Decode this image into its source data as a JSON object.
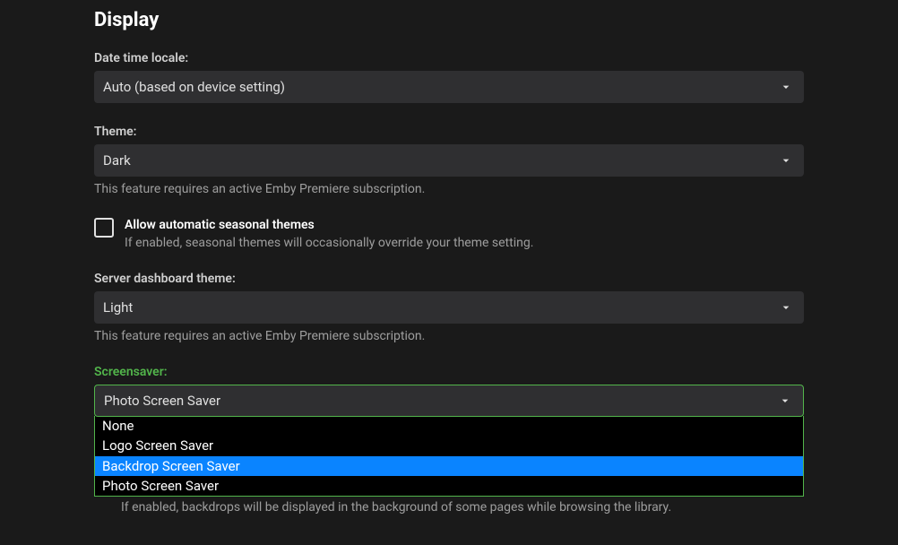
{
  "title": "Display",
  "datetime_locale": {
    "label": "Date time locale:",
    "value": "Auto (based on device setting)"
  },
  "theme": {
    "label": "Theme:",
    "value": "Dark",
    "help": "This feature requires an active Emby Premiere subscription."
  },
  "seasonal": {
    "label": "Allow automatic seasonal themes",
    "help": "If enabled, seasonal themes will occasionally override your theme setting."
  },
  "server_theme": {
    "label": "Server dashboard theme:",
    "value": "Light",
    "help": "This feature requires an active Emby Premiere subscription."
  },
  "screensaver": {
    "label": "Screensaver:",
    "value": "Photo Screen Saver",
    "options": [
      "None",
      "Logo Screen Saver",
      "Backdrop Screen Saver",
      "Photo Screen Saver"
    ],
    "highlighted_index": 2
  },
  "backdrops": {
    "help": "If enabled, backdrops will be displayed in the background of some pages while browsing the library."
  }
}
